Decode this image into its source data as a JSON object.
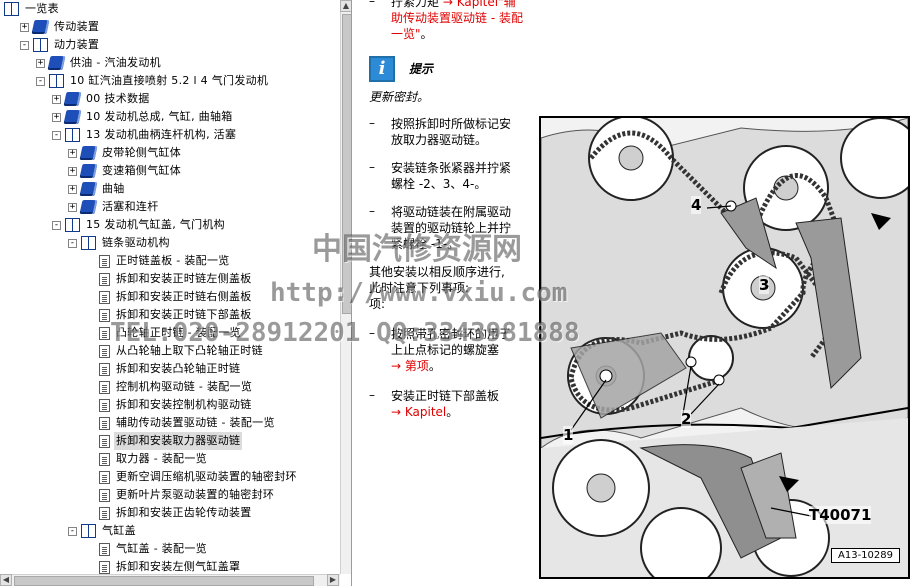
{
  "tree": {
    "nodes": [
      {
        "label": "一览表",
        "level": 0,
        "icon": "book-open",
        "toggle": "",
        "selected": false
      },
      {
        "label": "传动装置",
        "level": 1,
        "icon": "book-closed",
        "toggle": "+",
        "selected": false
      },
      {
        "label": "动力装置",
        "level": 1,
        "icon": "book-open",
        "toggle": "-",
        "selected": false
      },
      {
        "label": "供油 - 汽油发动机",
        "level": 2,
        "icon": "book-closed",
        "toggle": "+",
        "selected": false
      },
      {
        "label": "10 缸汽油直接喷射 5.2 l 4 气门发动机",
        "level": 2,
        "icon": "book-open",
        "toggle": "-",
        "selected": false
      },
      {
        "label": "00 技术数据",
        "level": 3,
        "icon": "book-closed",
        "toggle": "+",
        "selected": false
      },
      {
        "label": "10 发动机总成, 气缸, 曲轴箱",
        "level": 3,
        "icon": "book-closed",
        "toggle": "+",
        "selected": false
      },
      {
        "label": "13 发动机曲柄连杆机构, 活塞",
        "level": 3,
        "icon": "book-open",
        "toggle": "-",
        "selected": false
      },
      {
        "label": "皮带轮侧气缸体",
        "level": 4,
        "icon": "book-closed",
        "toggle": "+",
        "selected": false
      },
      {
        "label": "变速箱侧气缸体",
        "level": 4,
        "icon": "book-closed",
        "toggle": "+",
        "selected": false
      },
      {
        "label": "曲轴",
        "level": 4,
        "icon": "book-closed",
        "toggle": "+",
        "selected": false
      },
      {
        "label": "活塞和连杆",
        "level": 4,
        "icon": "book-closed",
        "toggle": "+",
        "selected": false
      },
      {
        "label": "15 发动机气缸盖, 气门机构",
        "level": 3,
        "icon": "book-open",
        "toggle": "-",
        "selected": false
      },
      {
        "label": "链条驱动机构",
        "level": 4,
        "icon": "book-open",
        "toggle": "-",
        "selected": false
      },
      {
        "label": "正时链盖板 - 装配一览",
        "level": 5,
        "icon": "page",
        "toggle": "",
        "selected": false
      },
      {
        "label": "拆卸和安装正时链左侧盖板",
        "level": 5,
        "icon": "page",
        "toggle": "",
        "selected": false
      },
      {
        "label": "拆卸和安装正时链右侧盖板",
        "level": 5,
        "icon": "page",
        "toggle": "",
        "selected": false
      },
      {
        "label": "拆卸和安装正时链下部盖板",
        "level": 5,
        "icon": "page",
        "toggle": "",
        "selected": false
      },
      {
        "label": "凸轮轴正时链 - 装配一览",
        "level": 5,
        "icon": "page",
        "toggle": "",
        "selected": false
      },
      {
        "label": "从凸轮轴上取下凸轮轴正时链",
        "level": 5,
        "icon": "page",
        "toggle": "",
        "selected": false
      },
      {
        "label": "拆卸和安装凸轮轴正时链",
        "level": 5,
        "icon": "page",
        "toggle": "",
        "selected": false
      },
      {
        "label": "控制机构驱动链 - 装配一览",
        "level": 5,
        "icon": "page",
        "toggle": "",
        "selected": false
      },
      {
        "label": "拆卸和安装控制机构驱动链",
        "level": 5,
        "icon": "page",
        "toggle": "",
        "selected": false
      },
      {
        "label": "辅助传动装置驱动链 - 装配一览",
        "level": 5,
        "icon": "page",
        "toggle": "",
        "selected": false
      },
      {
        "label": "拆卸和安装取力器驱动链",
        "level": 5,
        "icon": "page",
        "toggle": "",
        "selected": true
      },
      {
        "label": "取力器 - 装配一览",
        "level": 5,
        "icon": "page",
        "toggle": "",
        "selected": false
      },
      {
        "label": "更新空调压缩机驱动装置的轴密封环",
        "level": 5,
        "icon": "page",
        "toggle": "",
        "selected": false
      },
      {
        "label": "更新叶片泵驱动装置的轴密封环",
        "level": 5,
        "icon": "page",
        "toggle": "",
        "selected": false
      },
      {
        "label": "拆卸和安装正齿轮传动装置",
        "level": 5,
        "icon": "page",
        "toggle": "",
        "selected": false
      },
      {
        "label": "气缸盖",
        "level": 4,
        "icon": "book-open",
        "toggle": "-",
        "selected": false
      },
      {
        "label": "气缸盖 - 装配一览",
        "level": 5,
        "icon": "page",
        "toggle": "",
        "selected": false
      },
      {
        "label": "拆卸和安装左侧气缸盖罩",
        "level": 5,
        "icon": "page",
        "toggle": "",
        "selected": false
      }
    ]
  },
  "content": {
    "intro_prefix": "拧紧力矩",
    "intro_link": "→ Kapitel\"辅助传动装置驱动链 - 装配一览\"",
    "intro_link_line1": "→ Kapitel\"辅",
    "intro_link_line2": "助传动装置驱动链 - 装配",
    "intro_link_line3": "一览\"",
    "intro_end": "。",
    "tip_title": "提示",
    "tip_body": "更新密封。",
    "steps": [
      {
        "text1": "按照拆卸时所做标记安",
        "text2": "放取力器驱动链。"
      },
      {
        "text1": "安装链条张紧器并拧紧",
        "text2": "螺栓 -2、3、4-。"
      },
      {
        "text1": "将驱动链装在附属驱动",
        "text2": "装置的驱动链轮上并拧",
        "text3": "紧螺栓 -1-。"
      }
    ],
    "other_text1": "其他安装以相反顺序进行,",
    "other_text2": "此时注意下列事项:",
    "other_text3": "项:",
    "step4_text1": "按照带孔密封环的用于",
    "step4_text2": "上止点标记的螺旋塞",
    "step4_link": "→ 第项",
    "step4_end": "。",
    "step5_text": "安装正时链下部盖板",
    "step5_link": "→ Kapitel",
    "step5_end": "。"
  },
  "figure": {
    "callouts": [
      "4",
      "3",
      "1",
      "2",
      "T40071"
    ],
    "label": "A13-10289"
  },
  "watermark": {
    "line1": "中国汽修资源网",
    "line2": "http://www.vxiu.com",
    "line3": "TEL:020-28912201 QQ:3343981888"
  }
}
